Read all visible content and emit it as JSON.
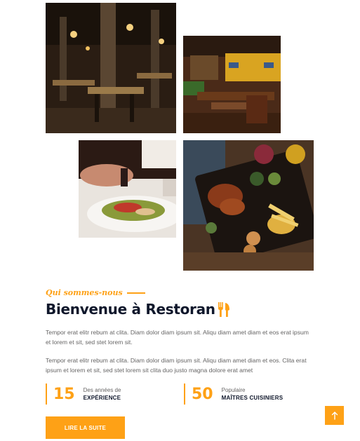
{
  "about": {
    "eyebrow": "Qui sommes-nous",
    "title": "Bienvenue à Restoran",
    "paragraph_1": "Tempor erat elitr rebum at clita. Diam dolor diam ipsum sit. Aliqu diam amet diam et eos erat ipsum et lorem et sit, sed stet lorem sit.",
    "paragraph_2": "Tempor erat elitr rebum at clita. Diam dolor diam ipsum sit. Aliqu diam amet diam et eos. Clita erat ipsum et lorem et sit, sed stet lorem sit clita duo justo magna dolore erat amet"
  },
  "stats": [
    {
      "number": "15",
      "line_1": "Des années de",
      "line_2": "EXPÉRIENCE"
    },
    {
      "number": "50",
      "line_1": "Populaire",
      "line_2": "MAÎTRES CUISINIERS"
    }
  ],
  "cta_label": "LIRE LA SUITE",
  "icons": {
    "title_icon": "utensils-icon",
    "back_to_top": "arrow-up-icon"
  },
  "colors": {
    "accent": "#fea116",
    "dark": "#0f172b",
    "body_text": "#666565"
  }
}
